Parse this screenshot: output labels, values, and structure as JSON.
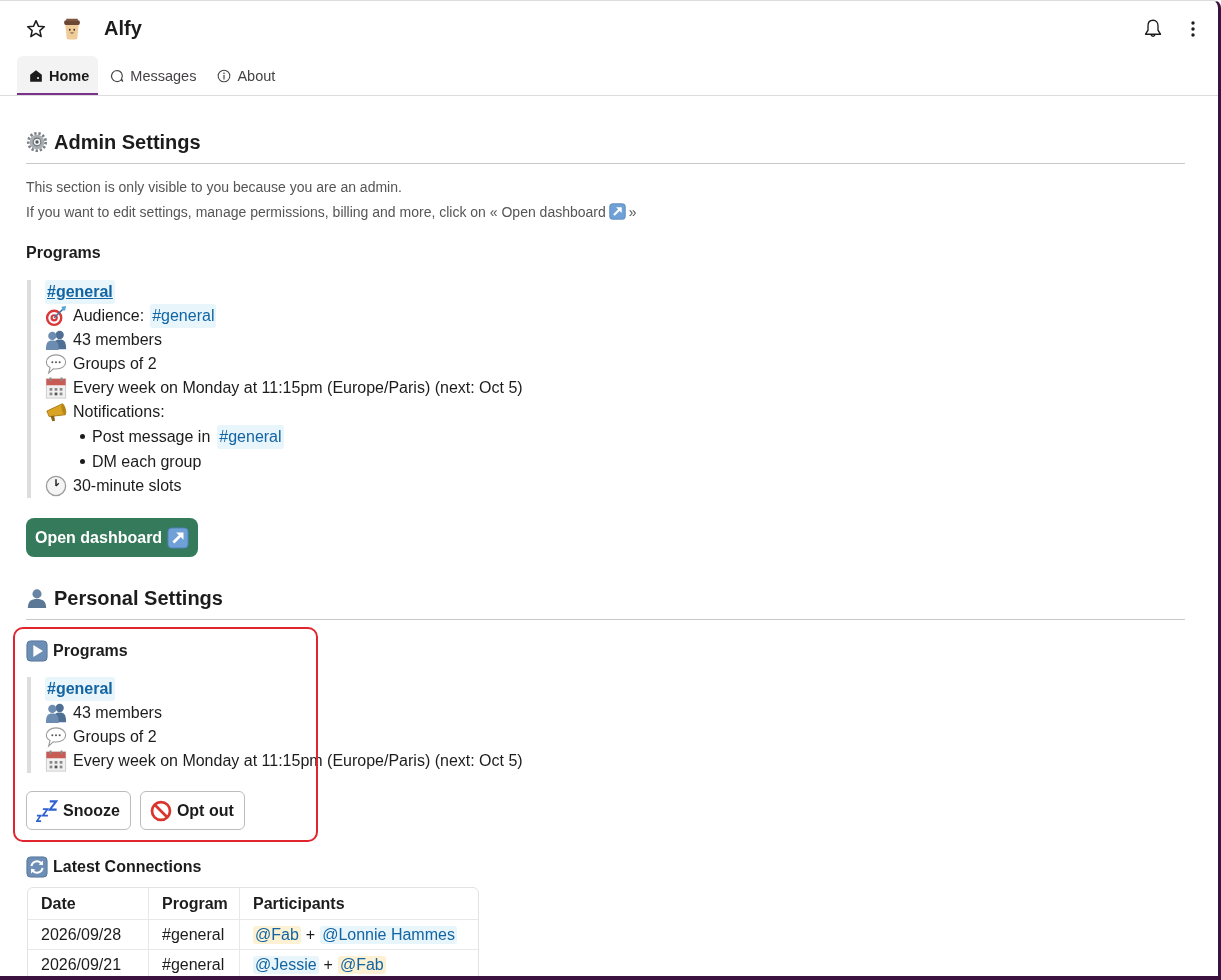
{
  "header": {
    "title": "Alfy",
    "starred": false
  },
  "tabs": [
    {
      "kind": "home",
      "label": "Home",
      "selected": true
    },
    {
      "kind": "messages",
      "label": "Messages",
      "selected": false
    },
    {
      "kind": "about",
      "label": "About",
      "selected": false
    }
  ],
  "admin": {
    "title": "Admin Settings",
    "notes": [
      {
        "text": "This section is only visible to you because you are an admin."
      },
      {
        "text": "If you want to edit settings, manage permissions, billing and more, click on « Open dashboard",
        "tail": "»"
      }
    ],
    "programs_title": "Programs",
    "program": {
      "channel": "#general",
      "underlined": true,
      "lines": [
        {
          "kind": "audience",
          "text": "Audience:",
          "channel": "#general"
        },
        {
          "kind": "members",
          "text": "43 members"
        },
        {
          "kind": "groups",
          "text": "Groups of 2"
        },
        {
          "kind": "schedule",
          "text": "Every week on Monday at 11:15pm (Europe/Paris) (next: Oct 5)"
        },
        {
          "kind": "notifications",
          "text": "Notifications:",
          "items": [
            {
              "text": "Post message in",
              "channel": "#general"
            },
            {
              "text": "DM each group"
            }
          ]
        },
        {
          "kind": "slots",
          "text": "30-minute slots"
        }
      ]
    },
    "button": {
      "label": "Open dashboard"
    }
  },
  "personal": {
    "title": "Personal Settings",
    "programs": {
      "title": "Programs",
      "highlighted": true,
      "program": {
        "channel": "#general",
        "underlined": false,
        "lines": [
          {
            "kind": "members",
            "text": "43 members"
          },
          {
            "kind": "groups",
            "text": "Groups of 2"
          },
          {
            "kind": "schedule",
            "text": "Every week on Monday at 11:15pm (Europe/Paris) (next: Oct 5)"
          }
        ]
      },
      "buttons": [
        {
          "kind": "snooze",
          "label": "Snooze"
        },
        {
          "kind": "opt_out",
          "label": "Opt out"
        }
      ]
    }
  },
  "connections": {
    "title": "Latest Connections",
    "columns": [
      "Date",
      "Program",
      "Participants"
    ],
    "rows": [
      {
        "date": "2026/09/28",
        "program": "#general",
        "joiner": "+",
        "participants": [
          {
            "name": "@Fab",
            "self": true
          },
          {
            "name": "@Lonnie Hammes",
            "self": false
          }
        ]
      },
      {
        "date": "2026/09/21",
        "program": "#general",
        "joiner": "+",
        "participants": [
          {
            "name": "@Jessie",
            "self": false
          },
          {
            "name": "@Fab",
            "self": true
          }
        ]
      }
    ]
  }
}
